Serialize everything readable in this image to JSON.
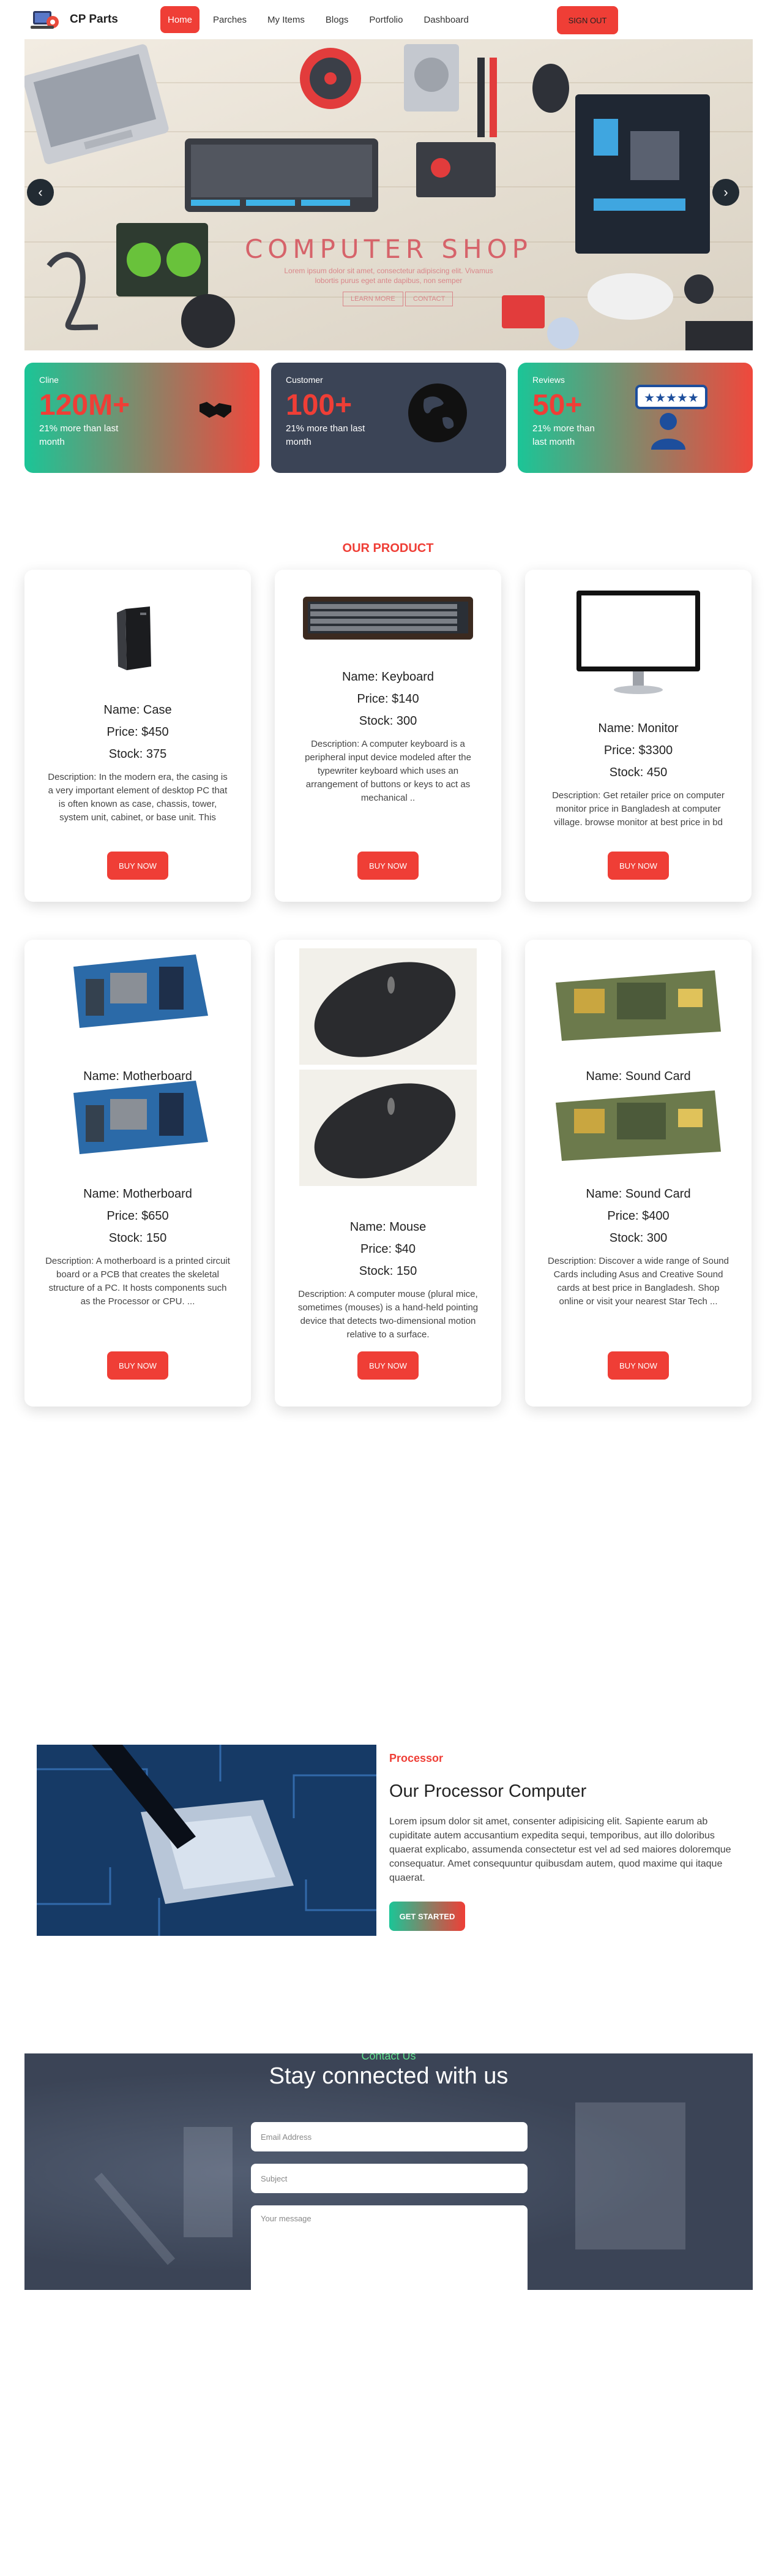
{
  "brand": {
    "name": "CP Parts"
  },
  "nav": {
    "items": [
      {
        "label": "Home",
        "active": true
      },
      {
        "label": "Parches",
        "active": false
      },
      {
        "label": "My Items",
        "active": false
      },
      {
        "label": "Blogs",
        "active": false
      },
      {
        "label": "Portfolio",
        "active": false
      },
      {
        "label": "Dashboard",
        "active": false
      }
    ],
    "signout": "SIGN OUT"
  },
  "hero": {
    "title": "COMPUTER SHOP",
    "subtitle_line1": "Lorem ipsum dolor sit amet, consectetur adipiscing elit. Vivamus",
    "subtitle_line2": "lobortis purus eget ante dapibus, non semper",
    "btn_learn": "LEARN MORE",
    "btn_contact": "CONTACT",
    "prev_icon": "chevron-left-icon",
    "next_icon": "chevron-right-icon"
  },
  "stats": [
    {
      "label": "Cline",
      "value": "120M+",
      "note": "21% more than last month",
      "icon": "handshake-icon"
    },
    {
      "label": "Customer",
      "value": "100+",
      "note": "21% more than last month",
      "icon": "globe-icon"
    },
    {
      "label": "Reviews",
      "value": "50+",
      "note": "21% more than last month",
      "icon": "review-icon"
    }
  ],
  "products_title": "OUR PRODUCT",
  "products": [
    {
      "name": "Name: Case",
      "price": "Price: $450",
      "stock": "Stock: 375",
      "desc": "Description: In the modern era, the casing is a very important element of desktop PC that is often known as case, chassis, tower, system unit, cabinet, or base unit. This",
      "buy": "BUY NOW"
    },
    {
      "name": "Name: Keyboard",
      "price": "Price: $140",
      "stock": "Stock: 300",
      "desc": "Description: A computer keyboard is a peripheral input device modeled after the typewriter keyboard which uses an arrangement of buttons or keys to act as mechanical ..",
      "buy": "BUY NOW"
    },
    {
      "name": "Name: Monitor",
      "price": "Price: $3300",
      "stock": "Stock: 450",
      "desc": "Description: Get retailer price on computer monitor price in Bangladesh at computer village. browse monitor at best price in bd with us from LG, hp, dell, Samsung, Acer, ...",
      "buy": "BUY NOW"
    },
    {
      "name": "Name: Motherboard",
      "price": "Price: $650",
      "stock": "Stock: 150",
      "desc": "Description: A motherboard is a printed circuit board or a PCB that creates the skeletal structure of a PC. It hosts components such as the Processor or CPU. ...",
      "buy": "BUY NOW"
    },
    {
      "name": "Name: Mouse",
      "price": "Price: $40",
      "stock": "Stock: 150",
      "desc": "Description: A computer mouse (plural mice, sometimes (mouses) is a hand-held pointing device that detects two-dimensional motion relative to a surface.",
      "buy": "BUY NOW"
    },
    {
      "name": "Name: Sound Card",
      "price": "Price: $400",
      "stock": "Stock: 300",
      "desc": "Description: Discover a wide range of Sound Cards including Asus and Creative Sound cards at best price in Bangladesh. Shop online or visit your nearest Star Tech ...",
      "buy": "BUY NOW"
    }
  ],
  "processor": {
    "tag": "Processor",
    "title": "Our Processor Computer",
    "text": "Lorem ipsum dolor sit amet, consenter adipisicing elit. Sapiente earum ab cupiditate autem accusantium expedita sequi, temporibus, aut illo doloribus quaerat explicabo, assumenda consectetur est vel ad sed maiores doloremque consequatur. Amet consequuntur quibusdam autem, quod maxime qui itaque quaerat.",
    "button": "GET STARTED"
  },
  "contact": {
    "tag": "Contact Us",
    "title": "Stay connected with us",
    "email_placeholder": "Email Address",
    "subject_placeholder": "Subject",
    "message_placeholder": "Your message"
  },
  "colors": {
    "accent": "#ef3e36",
    "green": "#1bc597",
    "dark_card": "#3b4456"
  }
}
